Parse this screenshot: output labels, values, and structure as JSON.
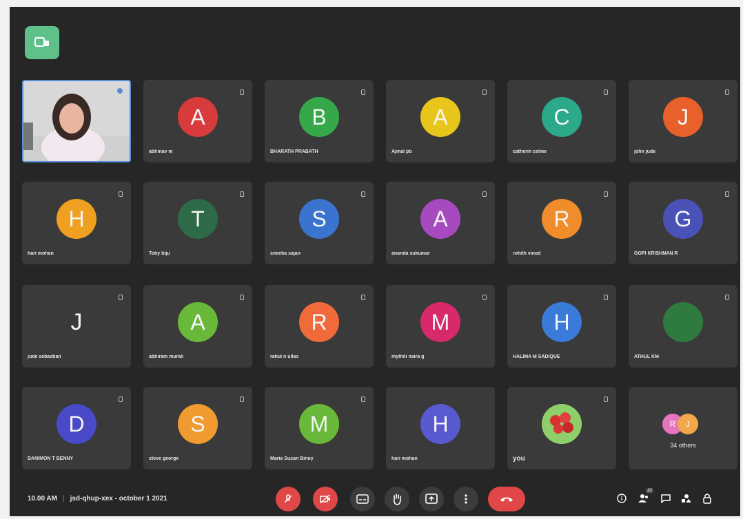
{
  "meeting": {
    "time": "10.00 AM",
    "separator": "|",
    "code_date": "jsd-qhup-xex - october 1 2021",
    "participant_count": "37"
  },
  "participants": [
    {
      "initial": "A",
      "name": "abhinav m",
      "color": "#d83b3b"
    },
    {
      "initial": "B",
      "name": "BHARATH PRABATH",
      "color": "#36a84a"
    },
    {
      "initial": "A",
      "name": "Ajmal pb",
      "color": "#e8c51a"
    },
    {
      "initial": "C",
      "name": "catherin celine",
      "color": "#2ba98a"
    },
    {
      "initial": "J",
      "name": "john jude",
      "color": "#e8602a"
    },
    {
      "initial": "H",
      "name": "hari mohan",
      "color": "#f0a020"
    },
    {
      "initial": "T",
      "name": "Toby biju",
      "color": "#2c6a48"
    },
    {
      "initial": "S",
      "name": "sneeha sajan",
      "color": "#3a74d0"
    },
    {
      "initial": "A",
      "name": "ananda sukumar",
      "color": "#a74ac0"
    },
    {
      "initial": "R",
      "name": "rohith vinod",
      "color": "#f08c2a"
    },
    {
      "initial": "G",
      "name": "GOPI KRISHNAN R",
      "color": "#4a52b8"
    },
    {
      "initial": "J",
      "name": "jude sebastian",
      "color": "transparent"
    },
    {
      "initial": "A",
      "name": "abhiram murali",
      "color": "#6ab83a"
    },
    {
      "initial": "R",
      "name": "rahul n ullas",
      "color": "#f06a3a"
    },
    {
      "initial": "M",
      "name": "mythili naira g",
      "color": "#d82a6a"
    },
    {
      "initial": "H",
      "name": "HALIMA M SADIQUE",
      "color": "#3a7ad8"
    },
    {
      "initial": "",
      "name": "ATHUL KM",
      "color": "#2f7a3e"
    },
    {
      "initial": "D",
      "name": "DANIMON T BENNY",
      "color": "#4a4ac8"
    },
    {
      "initial": "S",
      "name": "steve george",
      "color": "#f09a30"
    },
    {
      "initial": "M",
      "name": "Maria Susan Binoy",
      "color": "#6ab83a"
    },
    {
      "initial": "H",
      "name": "hari mohan",
      "color": "#5a5ad0"
    }
  ],
  "self_tile": {
    "name": "you"
  },
  "others_tile": {
    "initials": [
      "R",
      "J"
    ],
    "colors": [
      "#e874c0",
      "#f0a84a"
    ],
    "label": "34 others"
  },
  "colors": {
    "end_call": "#e04848",
    "accent": "#5fc08a"
  },
  "icons": {
    "mic": "mic-off-icon",
    "camera": "camera-off-icon",
    "captions": "captions-icon",
    "hand": "raise-hand-icon",
    "present": "present-screen-icon",
    "more": "more-options-icon",
    "end": "end-call-icon",
    "info": "info-icon",
    "people": "people-icon",
    "chat": "chat-icon",
    "activities": "activities-icon",
    "lock": "host-controls-icon"
  }
}
